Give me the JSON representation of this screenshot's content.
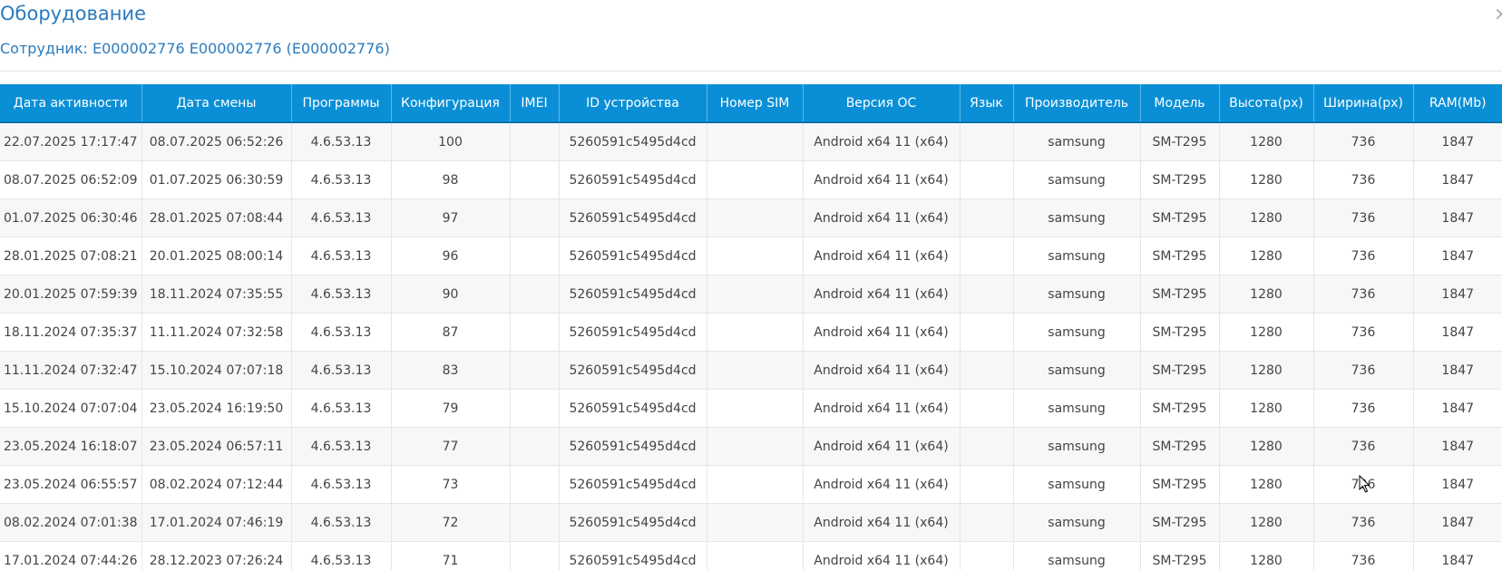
{
  "dialog": {
    "title": "Оборудование",
    "close_symbol": "×",
    "employee_line": "Сотрудник: E000002776 E000002776 (E000002776)"
  },
  "table": {
    "columns": [
      "Дата активности",
      "Дата смены",
      "Программы",
      "Конфигурация",
      "IMEI",
      "ID устройства",
      "Номер SIM",
      "Версия ОС",
      "Язык",
      "Производитель",
      "Модель",
      "Высота(px)",
      "Ширина(px)",
      "RAM(Mb)"
    ],
    "rows": [
      [
        "22.07.2025 17:17:47",
        "08.07.2025 06:52:26",
        "4.6.53.13",
        "100",
        "",
        "5260591c5495d4cd",
        "",
        "Android x64 11 (x64)",
        "",
        "samsung",
        "SM-T295",
        "1280",
        "736",
        "1847"
      ],
      [
        "08.07.2025 06:52:09",
        "01.07.2025 06:30:59",
        "4.6.53.13",
        "98",
        "",
        "5260591c5495d4cd",
        "",
        "Android x64 11 (x64)",
        "",
        "samsung",
        "SM-T295",
        "1280",
        "736",
        "1847"
      ],
      [
        "01.07.2025 06:30:46",
        "28.01.2025 07:08:44",
        "4.6.53.13",
        "97",
        "",
        "5260591c5495d4cd",
        "",
        "Android x64 11 (x64)",
        "",
        "samsung",
        "SM-T295",
        "1280",
        "736",
        "1847"
      ],
      [
        "28.01.2025 07:08:21",
        "20.01.2025 08:00:14",
        "4.6.53.13",
        "96",
        "",
        "5260591c5495d4cd",
        "",
        "Android x64 11 (x64)",
        "",
        "samsung",
        "SM-T295",
        "1280",
        "736",
        "1847"
      ],
      [
        "20.01.2025 07:59:39",
        "18.11.2024 07:35:55",
        "4.6.53.13",
        "90",
        "",
        "5260591c5495d4cd",
        "",
        "Android x64 11 (x64)",
        "",
        "samsung",
        "SM-T295",
        "1280",
        "736",
        "1847"
      ],
      [
        "18.11.2024 07:35:37",
        "11.11.2024 07:32:58",
        "4.6.53.13",
        "87",
        "",
        "5260591c5495d4cd",
        "",
        "Android x64 11 (x64)",
        "",
        "samsung",
        "SM-T295",
        "1280",
        "736",
        "1847"
      ],
      [
        "11.11.2024 07:32:47",
        "15.10.2024 07:07:18",
        "4.6.53.13",
        "83",
        "",
        "5260591c5495d4cd",
        "",
        "Android x64 11 (x64)",
        "",
        "samsung",
        "SM-T295",
        "1280",
        "736",
        "1847"
      ],
      [
        "15.10.2024 07:07:04",
        "23.05.2024 16:19:50",
        "4.6.53.13",
        "79",
        "",
        "5260591c5495d4cd",
        "",
        "Android x64 11 (x64)",
        "",
        "samsung",
        "SM-T295",
        "1280",
        "736",
        "1847"
      ],
      [
        "23.05.2024 16:18:07",
        "23.05.2024 06:57:11",
        "4.6.53.13",
        "77",
        "",
        "5260591c5495d4cd",
        "",
        "Android x64 11 (x64)",
        "",
        "samsung",
        "SM-T295",
        "1280",
        "736",
        "1847"
      ],
      [
        "23.05.2024 06:55:57",
        "08.02.2024 07:12:44",
        "4.6.53.13",
        "73",
        "",
        "5260591c5495d4cd",
        "",
        "Android x64 11 (x64)",
        "",
        "samsung",
        "SM-T295",
        "1280",
        "736",
        "1847"
      ],
      [
        "08.02.2024 07:01:38",
        "17.01.2024 07:46:19",
        "4.6.53.13",
        "72",
        "",
        "5260591c5495d4cd",
        "",
        "Android x64 11 (x64)",
        "",
        "samsung",
        "SM-T295",
        "1280",
        "736",
        "1847"
      ],
      [
        "17.01.2024 07:44:26",
        "28.12.2023 07:26:24",
        "4.6.53.13",
        "71",
        "",
        "5260591c5495d4cd",
        "",
        "Android x64 11 (x64)",
        "",
        "samsung",
        "SM-T295",
        "1280",
        "736",
        "1847"
      ]
    ]
  },
  "colors": {
    "title_blue": "#2a7bbf",
    "header_blue": "#0a8fd6"
  },
  "icons": {
    "close": "close-icon",
    "cursor": "mouse-pointer-icon"
  }
}
